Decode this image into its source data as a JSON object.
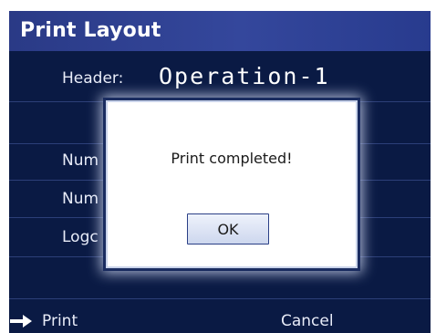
{
  "window": {
    "title": "Print Layout"
  },
  "header": {
    "label": "Header:",
    "value": "Operation-1"
  },
  "rows": [
    {
      "label": "Num"
    },
    {
      "label": "Num"
    },
    {
      "label": "Logc"
    }
  ],
  "footer": {
    "print_label": "Print",
    "print_icon": "right-arrow-icon",
    "cancel_label": "Cancel"
  },
  "dialog": {
    "message": "Print completed!",
    "ok_label": "OK"
  },
  "colors": {
    "background": "#0a1a44",
    "title_bar": "#34479c",
    "text": "#e8ecf8",
    "dialog_background": "#ffffff",
    "button_border": "#2a3f86"
  }
}
